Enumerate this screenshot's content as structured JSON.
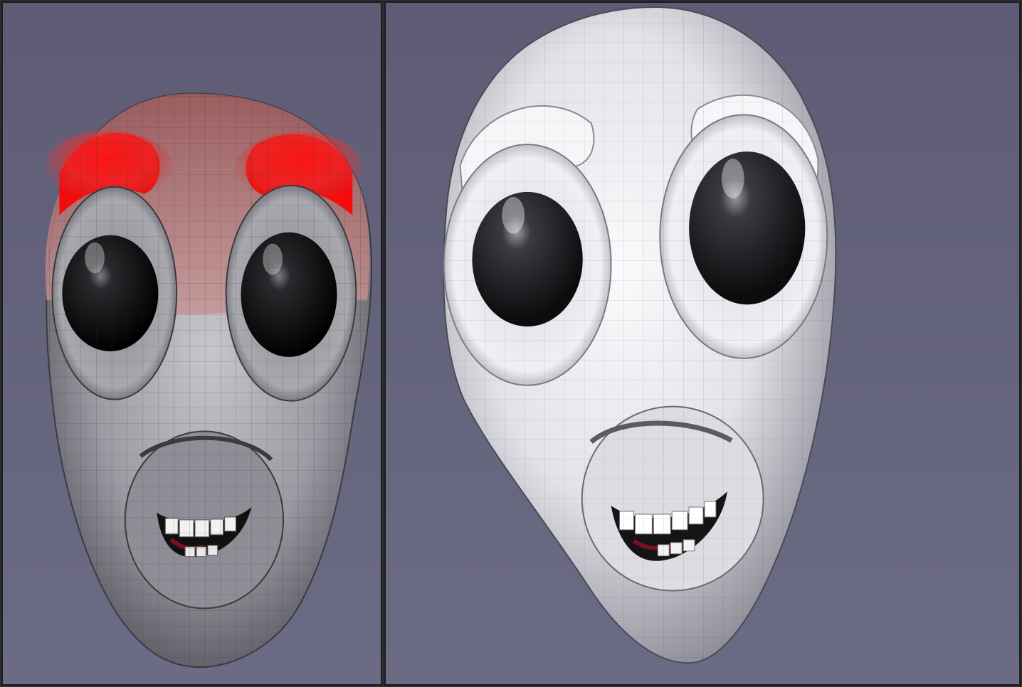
{
  "app": {
    "panels": [
      {
        "id": "left",
        "label": ""
      },
      {
        "id": "right",
        "label": ""
      }
    ]
  },
  "colors": {
    "viewport_bg": "#64637c",
    "frame": "#1d1d22",
    "mask_paint": "#ff0000",
    "skin_left": "#9a9aa2",
    "skin_right": "#e4e4e8",
    "eye": "#0c0c0e",
    "tongue": "#7a1020"
  },
  "icons": {
    "left_model": "head-mesh-icon",
    "right_model": "head-mesh-icon"
  }
}
